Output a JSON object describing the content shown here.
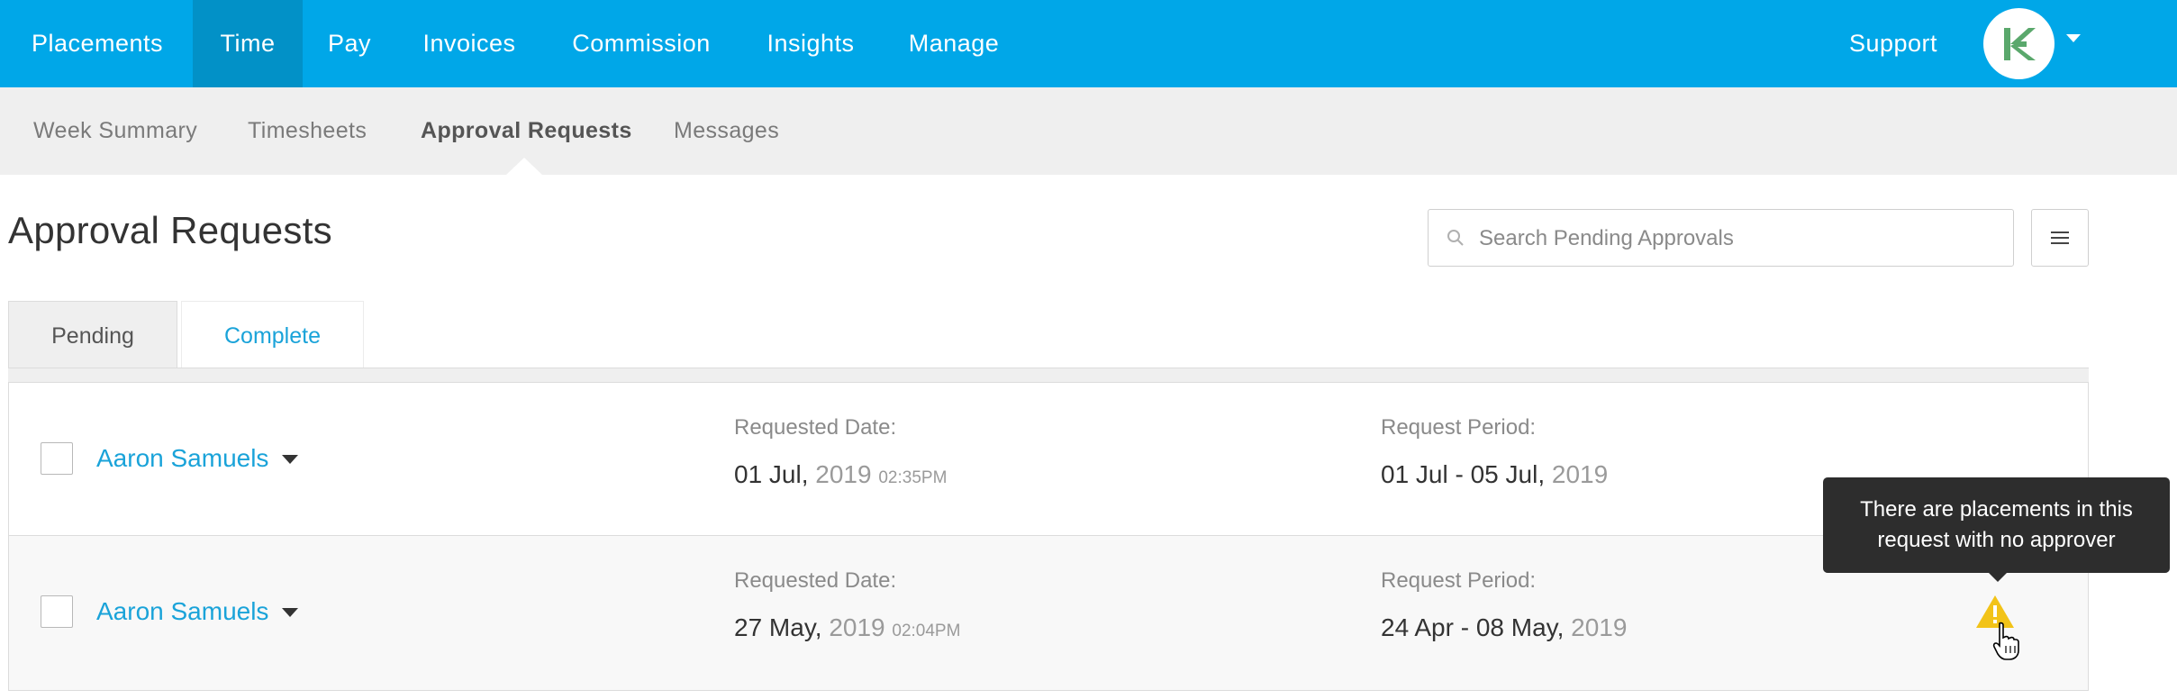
{
  "topnav": {
    "items": [
      "Placements",
      "Time",
      "Pay",
      "Invoices",
      "Commission",
      "Insights",
      "Manage"
    ],
    "active": "Time",
    "support": "Support",
    "avatar_icon": "brand-logo-icon",
    "colors": {
      "bar": "#00a7e8",
      "active": "#0291c7"
    }
  },
  "subnav": {
    "items": [
      "Week Summary",
      "Timesheets",
      "Approval Requests",
      "Messages"
    ],
    "active": "Approval Requests"
  },
  "page": {
    "title": "Approval Requests",
    "search_placeholder": "Search Pending Approvals"
  },
  "tabs": {
    "pending": "Pending",
    "complete": "Complete",
    "active": "Pending"
  },
  "requests": [
    {
      "name": "Aaron Samuels",
      "requested_label": "Requested Date:",
      "requested_day": "01 Jul,",
      "requested_year": "2019",
      "requested_time": "02:35PM",
      "period_label": "Request Period:",
      "period_range": "01 Jul - 05 Jul,",
      "period_year": "2019"
    },
    {
      "name": "Aaron Samuels",
      "requested_label": "Requested Date:",
      "requested_day": "27 May,",
      "requested_year": "2019",
      "requested_time": "02:04PM",
      "period_label": "Request Period:",
      "period_range": "24 Apr - 08 May,",
      "period_year": "2019",
      "warning": true
    }
  ],
  "tooltip": {
    "line1": "There are placements in this",
    "line2": "request with no approver"
  },
  "warning_color": "#f2c318"
}
